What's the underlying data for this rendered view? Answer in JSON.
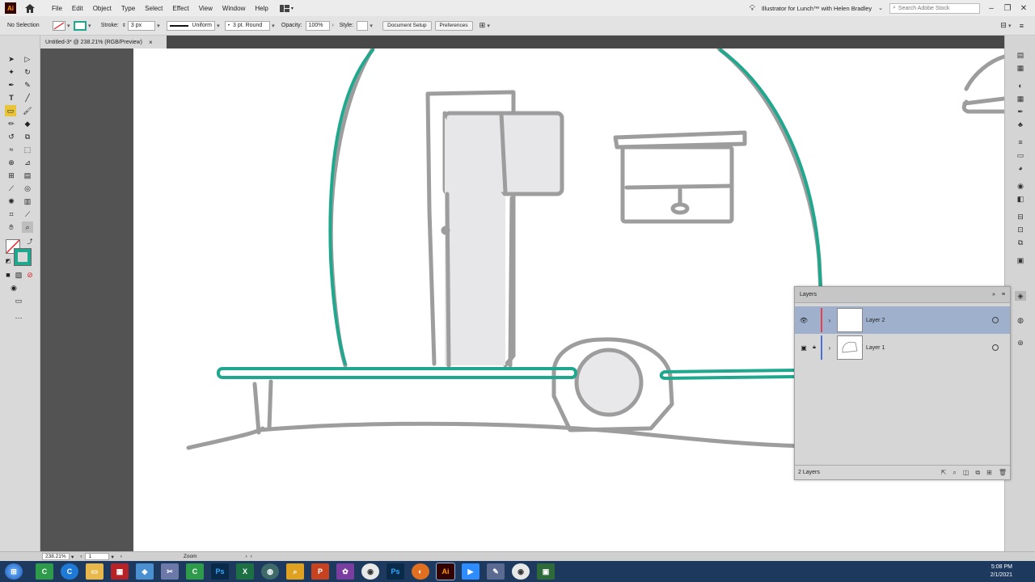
{
  "menubar": {
    "app_logo": "Ai",
    "items": [
      "File",
      "Edit",
      "Object",
      "Type",
      "Select",
      "Effect",
      "View",
      "Window",
      "Help"
    ],
    "window_title": "Illustrator for Lunch™ with Helen Bradley",
    "search_placeholder": "Search Adobe Stock"
  },
  "controlbar": {
    "selection_status": "No Selection",
    "stroke_label": "Stroke:",
    "stroke_weight": "3 px",
    "stroke_profile": "Uniform",
    "brush": "3 pt. Round",
    "opacity_label": "Opacity:",
    "opacity_value": "100%",
    "style_label": "Style:",
    "document_setup": "Document Setup",
    "preferences": "Preferences"
  },
  "tab": {
    "title": "Untitled-3* @ 238.21% (RGB/Preview)",
    "close": "×"
  },
  "layers_panel": {
    "title": "Layers",
    "layers": [
      {
        "name": "Layer 2",
        "color": "#e8404a",
        "selected": true,
        "locked": false
      },
      {
        "name": "Layer 1",
        "color": "#4a6fd8",
        "selected": false,
        "locked": true
      }
    ],
    "footer_count": "2 Layers"
  },
  "statusbar": {
    "zoom": "238.21%",
    "artboard": "1",
    "status_label": "Zoom"
  },
  "taskbar": {
    "time": "5:08 PM",
    "date": "2/1/2021"
  },
  "colors": {
    "teal_stroke": "#1fa88e",
    "sketch_gray": "#9a9a9a",
    "selected_layer": "#9fb0cd"
  }
}
